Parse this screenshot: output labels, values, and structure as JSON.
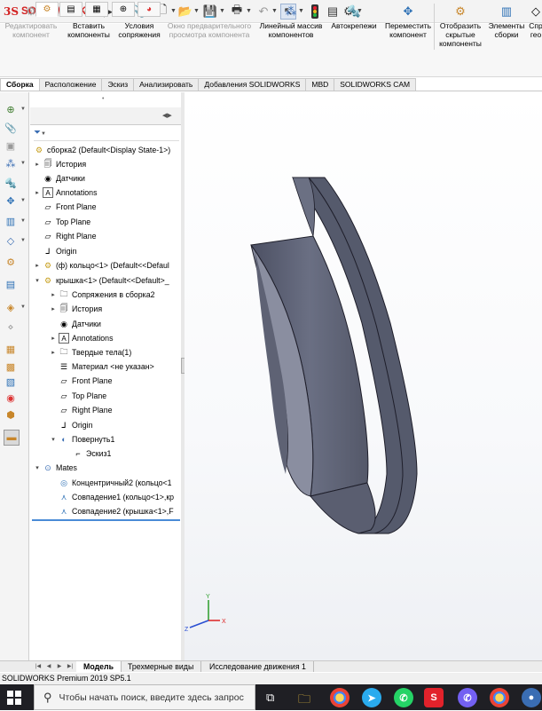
{
  "app": {
    "logo_ds": "3S",
    "logo_name": "SOLIDWORKS"
  },
  "quick_access": {
    "icons": [
      "home-icon",
      "new-icon",
      "open-icon",
      "save-icon",
      "print-icon",
      "undo-icon",
      "select-icon",
      "rebuild-icon",
      "file-properties-icon",
      "options-icon"
    ]
  },
  "command_manager": {
    "edit_component": "Редактировать компонент",
    "insert_components": "Вставить компоненты",
    "mate": "Условия сопряжения",
    "preview_window": "Окно предварительного просмотра компонента",
    "linear_pattern": "Линейный массив компонентов",
    "smart_fasteners": "Автокрепежи",
    "move_component": "Переместить компонент",
    "show_hidden": "Отобразить скрытые компоненты",
    "assembly_features": "Элементы сборки",
    "reference_geometry": "Спр гео"
  },
  "tabs": [
    {
      "label": "Сборка",
      "active": true
    },
    {
      "label": "Расположение"
    },
    {
      "label": "Эскиз"
    },
    {
      "label": "Анализировать"
    },
    {
      "label": "Добавления SOLIDWORKS"
    },
    {
      "label": "MBD"
    },
    {
      "label": "SOLIDWORKS CAM"
    }
  ],
  "tree": {
    "root": "сборка2  (Default<Display State-1>)",
    "history": "История",
    "sensors": "Датчики",
    "annotations": "Annotations",
    "front_plane": "Front Plane",
    "top_plane": "Top Plane",
    "right_plane": "Right Plane",
    "origin": "Origin",
    "part1": "(ф) кольцо<1> (Default<<Defaul",
    "part2": "крышка<1> (Default<<Default>_",
    "p2_mates": "Сопряжения в сборка2",
    "p2_history": "История",
    "p2_sensors": "Датчики",
    "p2_annotations": "Annotations",
    "p2_solid_bodies": "Твердые тела(1)",
    "p2_material": "Материал <не указан>",
    "p2_front": "Front Plane",
    "p2_top": "Top Plane",
    "p2_right": "Right Plane",
    "p2_origin": "Origin",
    "p2_revolve": "Повернуть1",
    "p2_sketch": "Эскиз1",
    "mates": "Mates",
    "mate1": "Концентричный2 (кольцо<1",
    "mate2": "Совпадение1 (кольцо<1>,кр",
    "mate3": "Совпадение2 (крышка<1>,F"
  },
  "bottom_tabs": [
    {
      "label": "Модель",
      "active": true
    },
    {
      "label": "Трехмерные виды"
    },
    {
      "label": "Исследование движения 1"
    }
  ],
  "status": "SOLIDWORKS Premium 2019 SP5.1",
  "taskbar": {
    "search_placeholder": "Чтобы начать поиск, введите здесь запрос"
  },
  "colors": {
    "accent": "#d32222",
    "part_body": "#5d6275",
    "selection": "#4a8bd6",
    "taskbar": "#1f1f24"
  }
}
